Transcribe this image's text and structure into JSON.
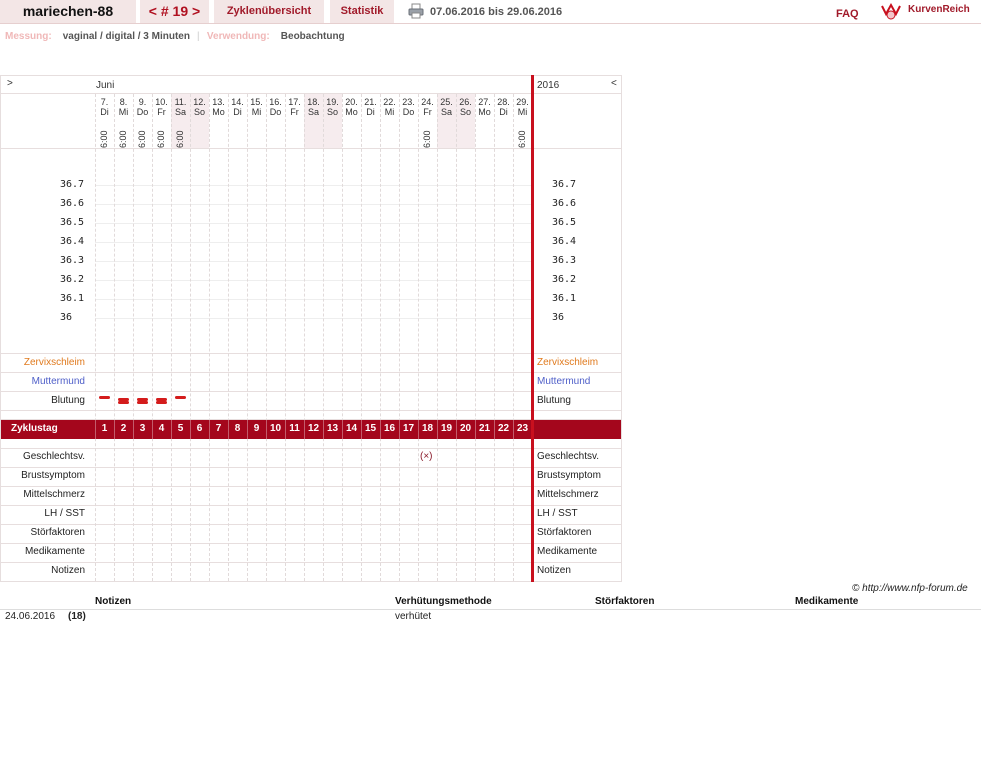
{
  "header": {
    "username": "mariechen-88",
    "cycle_nav": "< # 19 >",
    "overview_label": "Zyklenübersicht",
    "stats_label": "Statistik",
    "date_range": "07.06.2016 bis 29.06.2016",
    "faq_label": "FAQ",
    "logo_text": "KurvenReich"
  },
  "meta": {
    "measurement_label": "Messung:",
    "measurement_value": "vaginal / digital / 3 Minuten",
    "separator": "|",
    "usage_label": "Verwendung:",
    "usage_value": "Beobachtung"
  },
  "chart": {
    "left_arrow": ">",
    "right_arrow": "<",
    "month": "Juni",
    "year": "2016",
    "days": [
      "7.",
      "8.",
      "9.",
      "10.",
      "11.",
      "12.",
      "13.",
      "14.",
      "15.",
      "16.",
      "17.",
      "18.",
      "19.",
      "20.",
      "21.",
      "22.",
      "23.",
      "24.",
      "25.",
      "26.",
      "27.",
      "28.",
      "29."
    ],
    "weekdays": [
      "Di",
      "Mi",
      "Do",
      "Fr",
      "Sa",
      "So",
      "Mo",
      "Di",
      "Mi",
      "Do",
      "Fr",
      "Sa",
      "So",
      "Mo",
      "Di",
      "Mi",
      "Do",
      "Fr",
      "Sa",
      "So",
      "Mo",
      "Di",
      "Mi"
    ],
    "weekend_indices": [
      4,
      5,
      11,
      12,
      18,
      19
    ],
    "measure_times": [
      {
        "day_index": 0,
        "time": "6:00"
      },
      {
        "day_index": 1,
        "time": "6:00"
      },
      {
        "day_index": 2,
        "time": "6:00"
      },
      {
        "day_index": 3,
        "time": "6:00"
      },
      {
        "day_index": 4,
        "time": "6:00"
      },
      {
        "day_index": 17,
        "time": "6:00"
      },
      {
        "day_index": 22,
        "time": "6:00"
      }
    ],
    "temperature_labels": [
      "36.7",
      "36.6",
      "36.5",
      "36.4",
      "36.3",
      "36.2",
      "36.1",
      "36"
    ],
    "rows": {
      "cervical_mucus": "Zervixschleim",
      "cervix": "Muttermund",
      "bleeding": "Blutung",
      "cycle_day": "Zyklustag",
      "intercourse": "Geschlechtsv.",
      "breast": "Brustsymptom",
      "midpain": "Mittelschmerz",
      "lh": "LH / SST",
      "disturbance": "Störfaktoren",
      "medication": "Medikamente",
      "notes": "Notizen"
    },
    "cycle_days": [
      "1",
      "2",
      "3",
      "4",
      "5",
      "6",
      "7",
      "8",
      "9",
      "10",
      "11",
      "12",
      "13",
      "14",
      "15",
      "16",
      "17",
      "18",
      "19",
      "20",
      "21",
      "22",
      "23"
    ],
    "bleeding": [
      {
        "day_index": 0,
        "level": "light"
      },
      {
        "day_index": 1,
        "level": "medium"
      },
      {
        "day_index": 2,
        "level": "medium"
      },
      {
        "day_index": 3,
        "level": "medium"
      },
      {
        "day_index": 4,
        "level": "light"
      }
    ],
    "intercourse_mark": {
      "day_index": 17,
      "symbol": "(×)"
    },
    "colors": {
      "cervical_mucus": "#e07a1e",
      "cervix": "#4e5ec8",
      "cycle_bar": "#a4061c",
      "today_line": "#c8101e",
      "bleeding": "#d41c1c"
    }
  },
  "copyright": "© http://www.nfp-forum.de",
  "notes_table": {
    "headers": [
      "Notizen",
      "Verhütungsmethode",
      "Störfaktoren",
      "Medikamente"
    ],
    "rows": [
      {
        "date": "24.06.2016",
        "cycle_day": "(18)",
        "note": "",
        "method": "verhütet",
        "disturbance": "",
        "medication": ""
      }
    ]
  }
}
